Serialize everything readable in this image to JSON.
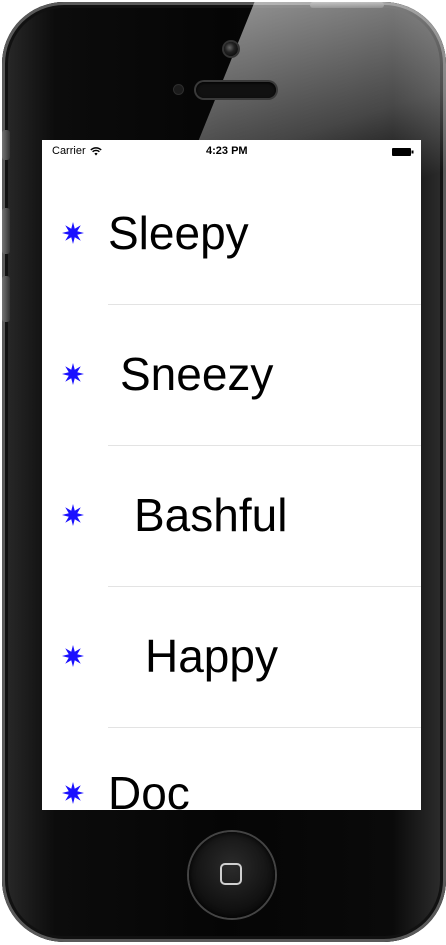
{
  "status_bar": {
    "carrier": "Carrier",
    "time": "4:23 PM",
    "wifi_icon": "wifi-icon",
    "battery_icon": "battery-icon"
  },
  "list": {
    "accent_color": "#1a10ff",
    "row_icon": "star-icon",
    "items": [
      {
        "label": "Sleepy"
      },
      {
        "label": "Sneezy"
      },
      {
        "label": "Bashful"
      },
      {
        "label": "Happy"
      },
      {
        "label": "Doc"
      }
    ]
  }
}
